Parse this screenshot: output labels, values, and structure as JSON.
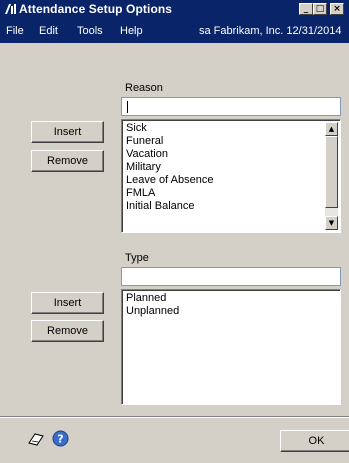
{
  "window": {
    "title": "Attendance Setup Options",
    "controls": {
      "minimize": "_",
      "maximize": "□",
      "close": "×"
    }
  },
  "menu": {
    "items": [
      "File",
      "Edit",
      "Tools",
      "Help"
    ],
    "company_info": "sa  Fabrikam, Inc.  12/31/2014"
  },
  "reason": {
    "label": "Reason",
    "input_value": "",
    "insert_label": "Insert",
    "remove_label": "Remove",
    "items": [
      "Sick",
      "Funeral",
      "Vacation",
      "Military",
      "Leave of Absence",
      "FMLA",
      "Initial Balance"
    ]
  },
  "type": {
    "label": "Type",
    "input_value": "",
    "insert_label": "Insert",
    "remove_label": "Remove",
    "items": [
      "Planned",
      "Unplanned"
    ]
  },
  "footer": {
    "ok_label": "OK",
    "icons": [
      "note-icon",
      "help-icon"
    ]
  },
  "colors": {
    "titlebar": "#0a246a",
    "window_face": "#d4d0c8",
    "text_on_dark": "#ffffff"
  }
}
